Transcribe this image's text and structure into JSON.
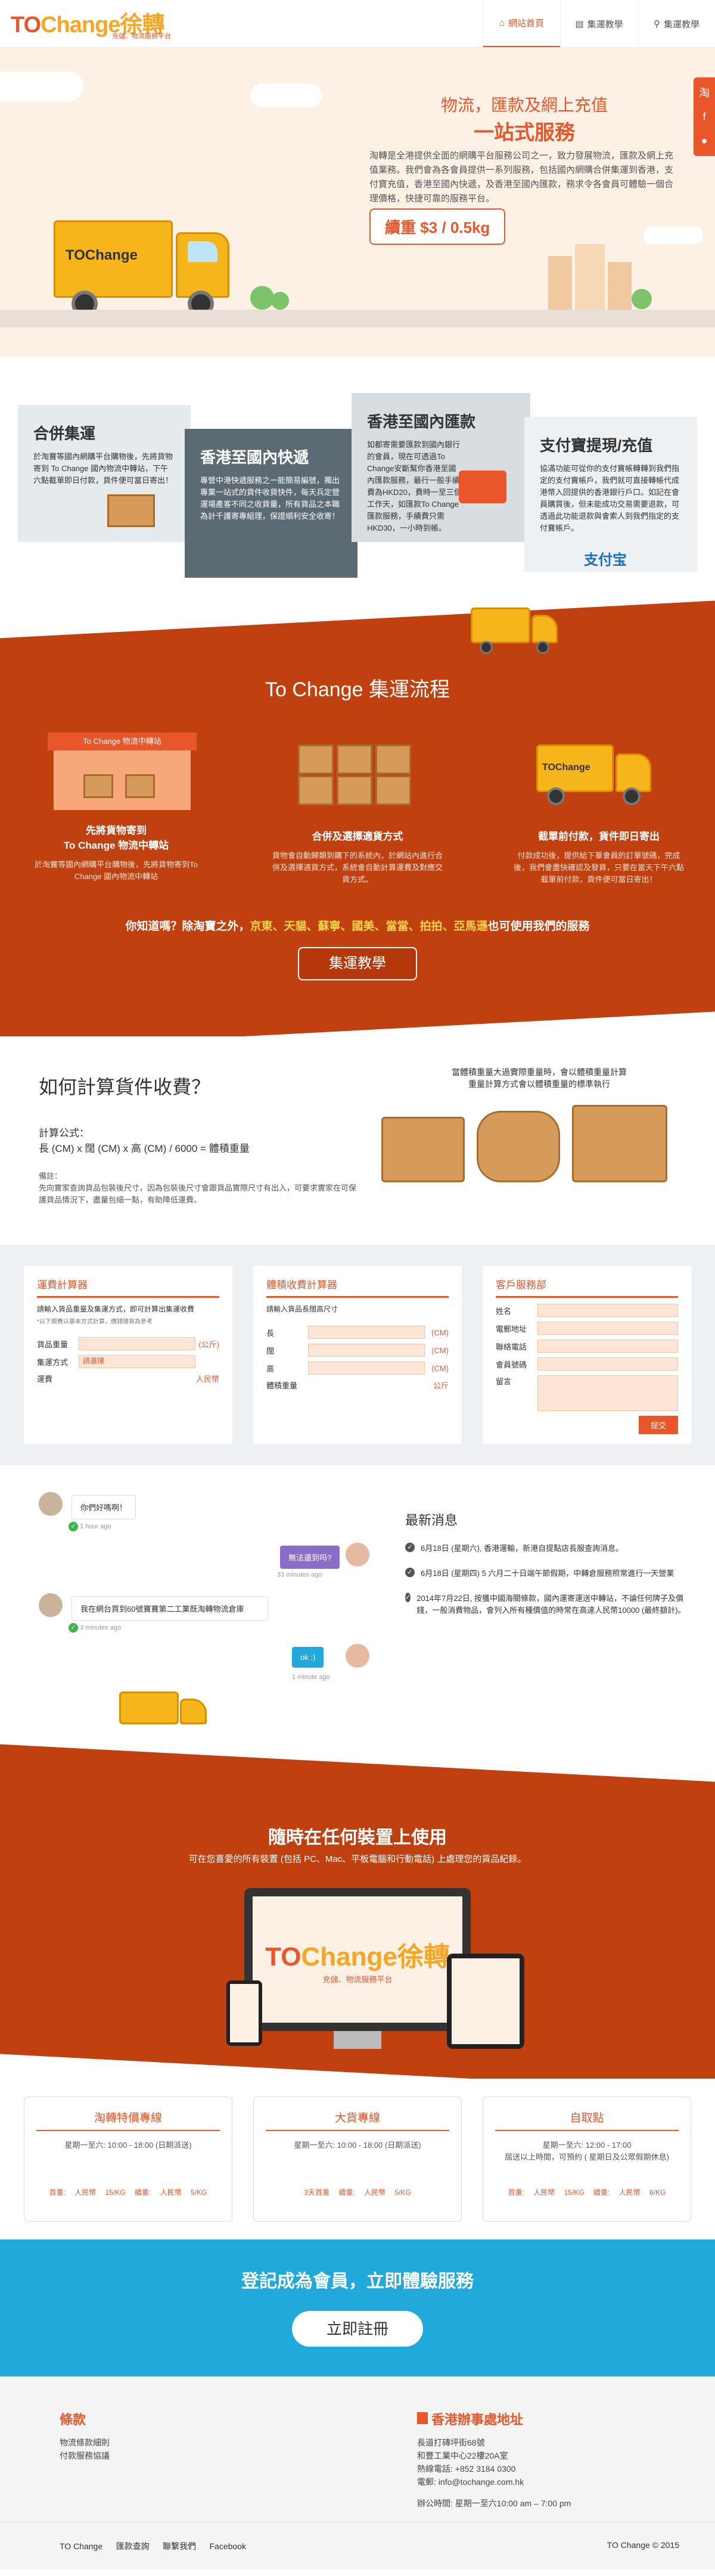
{
  "header": {
    "logo_prefix": "TO",
    "logo_main": "Change",
    "logo_cn": "徐轉",
    "tagline": "充儲、物流服務平台",
    "nav": [
      {
        "label": "網站首頁",
        "icon": "home-icon",
        "active": true
      },
      {
        "label": "集運教學",
        "icon": "book-icon",
        "active": false
      },
      {
        "label": "集運教學",
        "icon": "location-pin-icon",
        "active": false
      }
    ]
  },
  "social": [
    "淘",
    "f",
    "●"
  ],
  "hero": {
    "title": "物流，匯款及網上充值",
    "title2": "一站式服務",
    "desc": "淘轉是全港提供全面的網購平台服務公司之一，致力發展物流，匯款及網上充值業務。我們會為各會員提供一系列服務，包括國內網購合併集運到香港，支付寶充值，香港至國內快遞，及香港至國內匯款，務求令各會員可體驗一個合理價格，快捷可靠的服務平台。",
    "price": "續重 $3 / 0.5kg",
    "truck_logo": "TOChange"
  },
  "services": [
    {
      "title": "合併集運",
      "text": "於淘寶等國內網購平台購物後，先將貨物寄到 To Change 國內物流中轉站，下午六點截單即日付款，貨件便可當日寄出！"
    },
    {
      "title": "香港至國內快遞",
      "text": "專營中港快遞服務之一能簡易編號，獨出專業一站式的貨件收貨快件，每天兵定營運場產客不同之收貨量，所有貨品之本職為計千護寄專組理，保證順利安全收寄！"
    },
    {
      "title": "香港至國內匯款",
      "text": "如都寄需要匯款到國內銀行的會員，現在可透過To Change安斷幫你香港至國內匯款服務，最行一般手續費為HKD20，費時一至三個工作天，如匯款To Change匯款服務，手續費只需HKD30，一小時到帳。"
    },
    {
      "title": "支付寶提現/充值",
      "text": "協滿功能可從你的支付寶帳轉轉到我們指定的支付寶帳戶，我們就可直接轉帳代成港幣入回提供的香港銀行戶口。如記在會員購買後，但未能成功交易需要退款，可透過此功能退款與會索人到我們指定的支付寶帳戶。",
      "brand": "支付宝"
    }
  ],
  "process": {
    "title": "To Change 集運流程",
    "warehouse_sign": "To Change 物流中轉站",
    "truck_logo": "TOChange",
    "steps": [
      {
        "title": "先將貨物寄到\nTo Change 物流中轉站",
        "text": "於淘寶等國內網購平台購物後，先將貨物寄到To Change 國內物流中轉站"
      },
      {
        "title": "合併及選擇適貨方式",
        "text": "貨物會自動歸類到購下的系統內，於網站內進行合併及選擇適貨方式，系統會自動計算運費及對應交貨方式。"
      },
      {
        "title": "截單前付款，貨件即日寄出",
        "text": "付款成功後，提供給下單會員的訂單號碼，完成後，我們會盡快確認及發貨，只要在當天下午六點截單前付款，貨件便可當日寄出！"
      }
    ],
    "know_prefix": "你知道嗎？除淘寶之外，",
    "know_list": "京東、天貓、蘇寧、國美、當當、拍拍、亞馬遜",
    "know_suffix": "也可使用我們的服務",
    "button": "集運教學"
  },
  "calc": {
    "title": "如何計算貨件收費？",
    "note": "當體積重量大過實際重量時，會以體積重量計算\n重量計算方式會以體積重量的標準執行",
    "formula_label": "計算公式：",
    "formula": "長 (CM) x 闊 (CM) x 高 (CM) / 6000 = 體積重量",
    "remark_label": "備註：",
    "remark": "先向實家查詢貨品包裝後尺寸，因為包裝後尺寸會跟貨品實際尺寸有出入，可要求實家在可保護貨品情況下，盡量包細一點，有助降低運費。"
  },
  "tools": [
    {
      "title": "運費計算器",
      "desc": "請輸入貨品重量及集運方式，即可計算出集運收費",
      "hint": "*以下規費以基本方式計算，價錢隨貨為參考",
      "rows": [
        {
          "label": "貨品重量",
          "unit": "(公斤)"
        },
        {
          "label": "集運方式",
          "placeholder": "請選擇",
          "unit": ""
        },
        {
          "label": "運費",
          "unit": "人民幣"
        }
      ]
    },
    {
      "title": "體積收費計算器",
      "desc": "請輸入貨品長闊高尺寸",
      "rows": [
        {
          "label": "長",
          "unit": "(CM)"
        },
        {
          "label": "闊",
          "unit": "(CM)"
        },
        {
          "label": "高",
          "unit": "(CM)"
        },
        {
          "label": "體積重量",
          "unit": "公斤"
        }
      ]
    },
    {
      "title": "客戶服務部",
      "rows": [
        {
          "label": "姓名"
        },
        {
          "label": "電郵地址"
        },
        {
          "label": "聯絡電話"
        },
        {
          "label": "會員號碼"
        },
        {
          "label": "留言"
        }
      ],
      "submit": "提交"
    }
  ],
  "chat": [
    {
      "text": "你們好嗎啊！",
      "time": "1 hour ago",
      "side": "left"
    },
    {
      "text": "無法還到吗?",
      "time": "33 minutes ago",
      "side": "right"
    },
    {
      "text": "我在網台買到60號寶寶第二工業既淘轉物流倉庫",
      "time": "3 minutes ago",
      "side": "left"
    },
    {
      "text": "ok :)",
      "time": "1 minute ago",
      "side": "right"
    }
  ],
  "news": {
    "title": "最新消息",
    "items": [
      "6月18日 (星期六), 香港運輸，新港自提點店長服查詢消息。",
      "6月18日 (星期四) 5 六月二十日端午節假期，中轉倉服務照常進行一天營業",
      "2014年7月22日, 按獲中國海關條款，國內運寄運送中轉站，不論任何牌子及價錢，一般消費物品，會列入所有種價值的時常在高達人民幣10000 (最終額計)。"
    ]
  },
  "devices": {
    "title": "隨時在任何裝置上使用",
    "sub": "可在您喜愛的所有裝置 (包括 PC、Mac、平板電腦和行動電話) 上處理您的貨品紀錄。",
    "tagline": "充儲、物流服務平台"
  },
  "branches": [
    {
      "name": "淘轉特價專線",
      "hours": "星期一至六: 10:00 - 18:00 (日期派送)",
      "price1": "首重: 人民幣 15/KG",
      "price2": "續重: 人民幣 5/KG"
    },
    {
      "name": "大貨專線",
      "hours": "星期一至六: 10:00 - 18:00 (日期派送)",
      "price1": "3天首重",
      "price2": "續重: 人民幣 5/KG"
    },
    {
      "name": "自取點",
      "hours": "星期一至六: 12:00 - 17:00\n屆送以上時間，可預約 ( 星期日及公眾假期休息)",
      "price1": "首重: 人民幣 15/KG",
      "price2": "續重: 人民幣 6/KG"
    }
  ],
  "register": {
    "title": "登記成為會員，立即體驗服務",
    "button": "立即註冊"
  },
  "footer": {
    "terms_title": "條款",
    "terms": [
      "物流條款細則",
      "付款服務協議"
    ],
    "office_title": "香港辦事處地址",
    "address": [
      "長道打磚坪街68號",
      "和豐工業中心22樓20A室"
    ],
    "phone": "熱線電話: +852 3184 0300",
    "email": "電郵: info@tochange.com.hk",
    "hours": "辦公時間: 星期一至六10:00 am – 7:00 pm"
  },
  "bottom": {
    "links": [
      "TO Change",
      "匯款查詢",
      "聯繫我們",
      "Facebook"
    ],
    "copyright": "TO Change © 2015"
  },
  "colors": {
    "accent": "#e8562a",
    "orange_bg": "#c0400f",
    "blue": "#21a9dc",
    "truck": "#f6b51a"
  }
}
